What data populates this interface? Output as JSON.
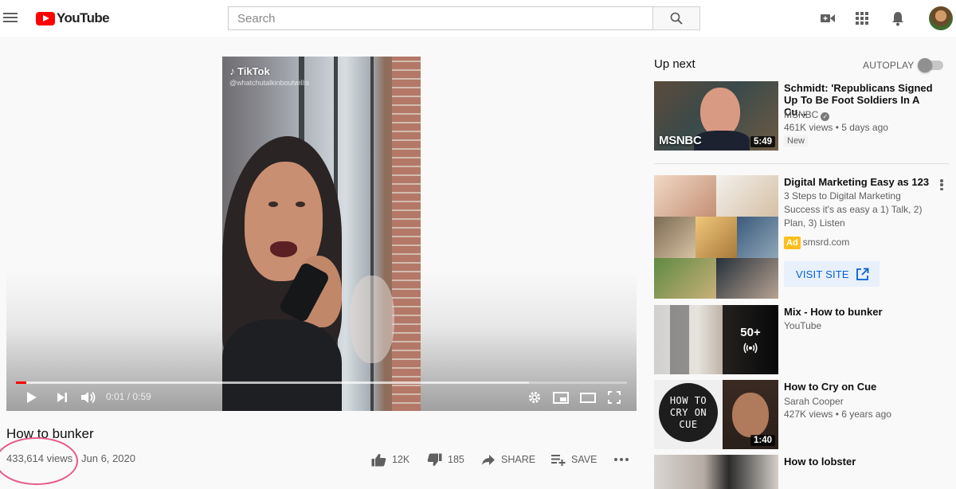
{
  "header": {
    "logo_text": "YouTube",
    "search_placeholder": "Search"
  },
  "player": {
    "watermark_brand": "TikTok",
    "watermark_handle": "@whatchutalkinboutwillis",
    "time_display": "0:01 / 0:59",
    "progress_fraction": 0.017,
    "buffered_fraction": 0.84
  },
  "video": {
    "title": "How to bunker",
    "views": "433,614 views",
    "date": "Jun 6, 2020",
    "likes": "12K",
    "dislikes": "185",
    "share_label": "SHARE",
    "save_label": "SAVE"
  },
  "sidebar": {
    "up_next": "Up next",
    "autoplay": "AUTOPLAY",
    "autoplay_on": false,
    "items": [
      {
        "title": "Schmidt: 'Republicans Signed Up To Be Foot Soldiers In A Cu...",
        "channel": "MSNBC",
        "meta": "461K views • 5 days ago",
        "badge": "New",
        "duration": "5:49",
        "thumb_brand": "MSNBC"
      },
      {
        "title": "Digital Marketing Easy as 123",
        "description": "3 Steps to Digital Marketing Success it's as easy a 1) Talk, 2) Plan, 3) Listen",
        "ad_label": "Ad",
        "domain": "smsrd.com",
        "cta": "VISIT SITE"
      },
      {
        "title": "Mix - How to bunker",
        "channel": "YouTube",
        "count": "50+"
      },
      {
        "title": "How to Cry on Cue",
        "channel": "Sarah Cooper",
        "meta": "427K views • 6 years ago",
        "duration": "1:40",
        "thumb_text": "HOW TO CRY ON CUE"
      },
      {
        "title": "How to lobster"
      }
    ]
  },
  "colors": {
    "brand_red": "#ff0000",
    "link_blue": "#065fd4",
    "ad_yellow": "#fcbf1e",
    "annotation_pink": "#e75a8d"
  },
  "icons": [
    "menu-icon",
    "search-icon",
    "video-camera-icon",
    "apps-grid-icon",
    "bell-icon",
    "play-icon",
    "next-icon",
    "volume-icon",
    "settings-icon",
    "miniplayer-icon",
    "theater-icon",
    "fullscreen-icon",
    "thumbs-up-icon",
    "thumbs-down-icon",
    "share-icon",
    "add-to-playlist-icon",
    "more-icon",
    "verified-icon",
    "external-link-icon",
    "radio-icon"
  ]
}
